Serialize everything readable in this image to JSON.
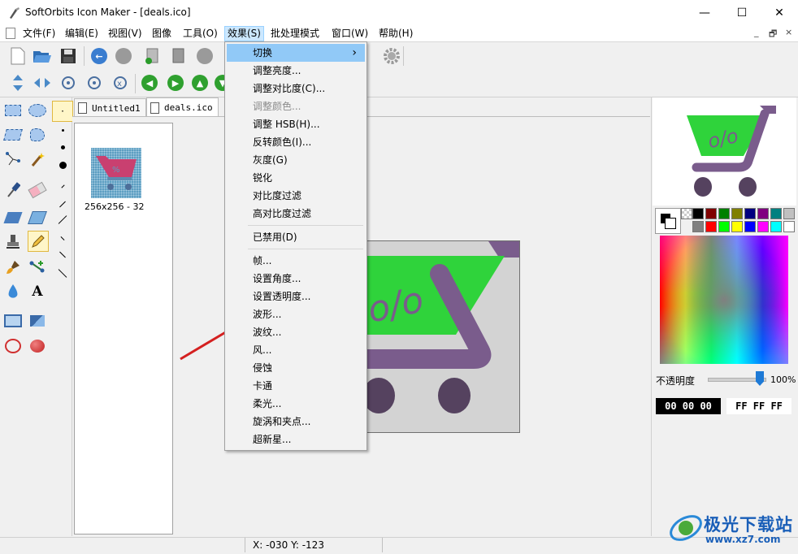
{
  "window": {
    "title": "SoftOrbits Icon Maker - [deals.ico]",
    "minimize": "—",
    "maximize": "☐",
    "close": "✕"
  },
  "menubar": {
    "items": [
      "文件(F)",
      "编辑(E)",
      "视图(V)",
      "图像",
      "工具(O)",
      "效果(S)",
      "批处理模式",
      "窗口(W)",
      "帮助(H)"
    ],
    "active": "效果(S)",
    "mdi_controls": [
      "_",
      "🗗",
      "×"
    ]
  },
  "tabs": [
    {
      "label": "Untitled1",
      "active": false
    },
    {
      "label": "deals.ico",
      "active": true
    }
  ],
  "icon_list": {
    "thumb_label": "256x256 - 32"
  },
  "effects_menu": {
    "items": [
      {
        "label": "切换",
        "submenu": true,
        "highlighted": true
      },
      {
        "label": "调整亮度..."
      },
      {
        "label": "调整对比度(C)..."
      },
      {
        "label": "调整颜色...",
        "disabled": true
      },
      {
        "label": "调整 HSB(H)..."
      },
      {
        "label": "反转颜色(I)..."
      },
      {
        "label": "灰度(G)"
      },
      {
        "label": "锐化"
      },
      {
        "label": "对比度过滤"
      },
      {
        "label": "高对比度过滤"
      },
      {
        "separator": true
      },
      {
        "label": "已禁用(D)"
      },
      {
        "separator": true
      },
      {
        "label": "帧..."
      },
      {
        "label": "设置角度..."
      },
      {
        "label": "设置透明度..."
      },
      {
        "label": "波形..."
      },
      {
        "label": "波纹..."
      },
      {
        "label": "风..."
      },
      {
        "label": "侵蚀"
      },
      {
        "label": "卡通"
      },
      {
        "label": "柔光..."
      },
      {
        "label": "旋涡和夹点..."
      },
      {
        "label": "超新星..."
      }
    ],
    "submenu_arrow": "›"
  },
  "color_panel": {
    "palette_row1": [
      "#000000",
      "#800000",
      "#008000",
      "#808000",
      "#000080",
      "#800080",
      "#008080",
      "#c0c0c0"
    ],
    "palette_row2": [
      "#808080",
      "#ff0000",
      "#00ff00",
      "#ffff00",
      "#0000ff",
      "#ff00ff",
      "#00ffff",
      "#ffffff"
    ],
    "opacity_label": "不透明度",
    "opacity_value": "100%",
    "opacity_level": 1.0,
    "fg_hex": "00 00 00",
    "bg_hex": "FF FF FF"
  },
  "status": {
    "coords": "X: -030 Y: -123"
  },
  "watermark": {
    "brand": "极光下载站",
    "url": "www.xz7.com"
  },
  "colors": {
    "cart_green": "#2fd33b",
    "cart_purple": "#7a5c8c",
    "wheel_dark": "#55425f",
    "menu_highlight": "#91c9f7",
    "arrow_red": "#d42020"
  }
}
